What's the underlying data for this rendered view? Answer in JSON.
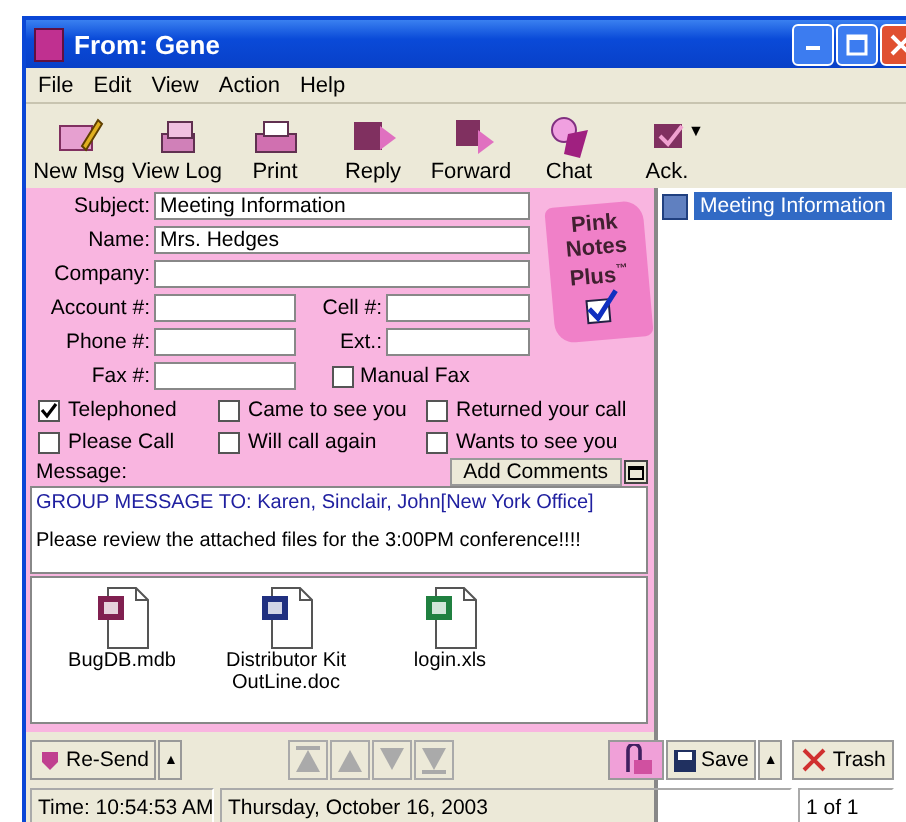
{
  "window": {
    "title": "From: Gene"
  },
  "menu": [
    "File",
    "Edit",
    "View",
    "Action",
    "Help"
  ],
  "toolbar": [
    {
      "label": "New Msg",
      "kind": "new"
    },
    {
      "label": "View Log",
      "kind": "log"
    },
    {
      "label": "Print",
      "kind": "print"
    },
    {
      "label": "Reply",
      "kind": "reply"
    },
    {
      "label": "Forward",
      "kind": "forward"
    },
    {
      "label": "Chat",
      "kind": "chat"
    },
    {
      "label": "Ack.",
      "kind": "ack"
    }
  ],
  "toolbar_caret": "▼",
  "form": {
    "subject": {
      "label": "Subject:",
      "value": "Meeting Information"
    },
    "name": {
      "label": "Name:",
      "value": "Mrs. Hedges"
    },
    "company": {
      "label": "Company:"
    },
    "account": {
      "label": "Account #:"
    },
    "cell": {
      "label": "Cell #:"
    },
    "phone": {
      "label": "Phone #:"
    },
    "ext": {
      "label": "Ext.:"
    },
    "fax": {
      "label": "Fax #:"
    },
    "manual_fax": {
      "label": "Manual Fax",
      "checked": false
    }
  },
  "logo": {
    "lines": [
      "Pink",
      "Notes",
      "Plus"
    ],
    "mark": "™"
  },
  "flags": [
    {
      "label": "Telephoned",
      "checked": true
    },
    {
      "label": "Came to see you",
      "checked": false
    },
    {
      "label": "Returned your call",
      "checked": false
    },
    {
      "label": "Please Call",
      "checked": false
    },
    {
      "label": "Will call again",
      "checked": false
    },
    {
      "label": "Wants to see you",
      "checked": false
    }
  ],
  "message": {
    "label": "Message:",
    "add_comments": "Add Comments",
    "header": "GROUP MESSAGE TO: Karen, Sinclair, John[New York Office]",
    "body": "Please review the attached files for the 3:00PM conference!!!!"
  },
  "attachments": [
    {
      "name": "BugDB.mdb",
      "kind": "mdb"
    },
    {
      "name": "Distributor Kit OutLine.doc",
      "kind": "doc"
    },
    {
      "name": "login.xls",
      "kind": "xls"
    }
  ],
  "list": [
    {
      "label": "Meeting Information",
      "selected": true
    }
  ],
  "bottom_bar": {
    "resend": "Re-Send",
    "resend_caret": "▲",
    "save": "Save",
    "save_caret": "▲",
    "trash": "Trash"
  },
  "status_bar": {
    "time": "Time: 10:54:53 AM",
    "date": "Thursday, October 16, 2003",
    "page": "1 of 1"
  }
}
